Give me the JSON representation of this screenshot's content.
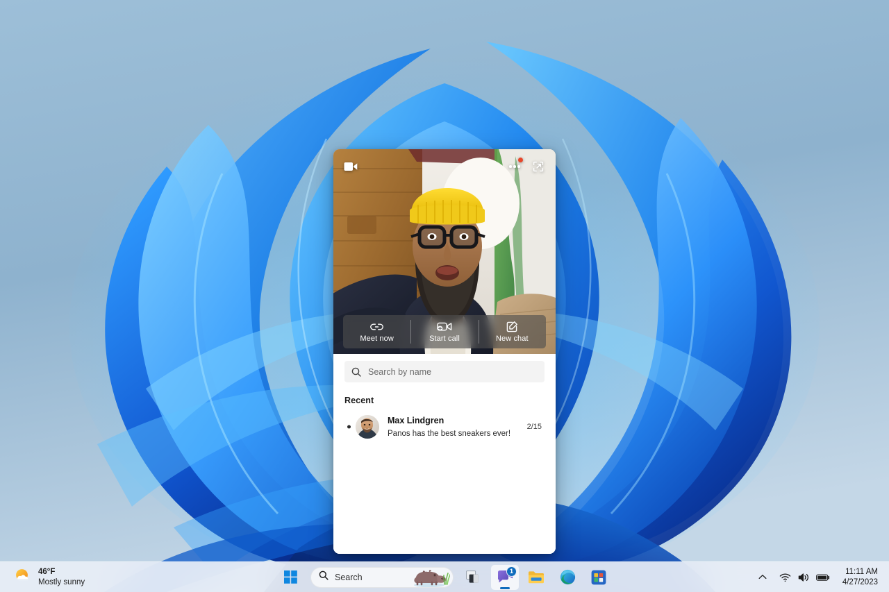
{
  "desktop": {
    "wallpaper_name": "windows-11-bloom-wallpaper",
    "background_color": "#8fb3cf",
    "bloom_colors": [
      "#0b57d0",
      "#1a7ff0",
      "#2d9bff",
      "#5ec2ff",
      "#0a2f9e",
      "#061a52"
    ]
  },
  "teams_flyout": {
    "panel_name": "Microsoft Teams chat flyout",
    "video_camera_icon": "video-camera-icon",
    "more_options_icon": "more-options-icon",
    "more_options_has_badge": true,
    "badge_color": "#e8472a",
    "expand_icon": "pop-out-icon",
    "actions": [
      {
        "label": "Meet now",
        "icon": "link-icon"
      },
      {
        "label": "Start call",
        "icon": "video-call-add-icon"
      },
      {
        "label": "New chat",
        "icon": "compose-icon"
      }
    ],
    "search": {
      "icon": "search-icon",
      "placeholder": "Search by name",
      "value": ""
    },
    "section_label": "Recent",
    "chats": [
      {
        "name": "Max Lindgren",
        "preview": "Panos has the best sneakers ever!",
        "time": "2/15",
        "unread": true,
        "avatar": "avatar-max-lindgren"
      }
    ]
  },
  "taskbar": {
    "weather": {
      "icon": "sun-cloud-icon",
      "temperature": "46°F",
      "condition": "Mostly sunny"
    },
    "start": {
      "label": "Start",
      "icon": "windows-logo-icon",
      "color": "#0f87e0"
    },
    "search": {
      "icon": "search-icon",
      "placeholder": "Search",
      "decoration_icon": "hippo-icon"
    },
    "apps": [
      {
        "name": "task-view",
        "label": "Task view",
        "icon": "task-view-icon",
        "active": false,
        "badge": ""
      },
      {
        "name": "microsoft-teams",
        "label": "Microsoft Teams",
        "icon": "teams-chat-icon",
        "active": true,
        "badge": "1"
      },
      {
        "name": "file-explorer",
        "label": "File Explorer",
        "icon": "folder-icon",
        "active": false,
        "badge": ""
      },
      {
        "name": "microsoft-edge",
        "label": "Microsoft Edge",
        "icon": "edge-icon",
        "active": false,
        "badge": ""
      },
      {
        "name": "microsoft-store",
        "label": "Microsoft Store",
        "icon": "store-icon",
        "active": false,
        "badge": ""
      }
    ],
    "tray": {
      "chevron_icon": "chevron-up-icon",
      "wifi_icon": "wifi-icon",
      "volume_icon": "volume-icon",
      "battery_icon": "battery-icon",
      "time": "11:11 AM",
      "date": "4/27/2023"
    }
  }
}
